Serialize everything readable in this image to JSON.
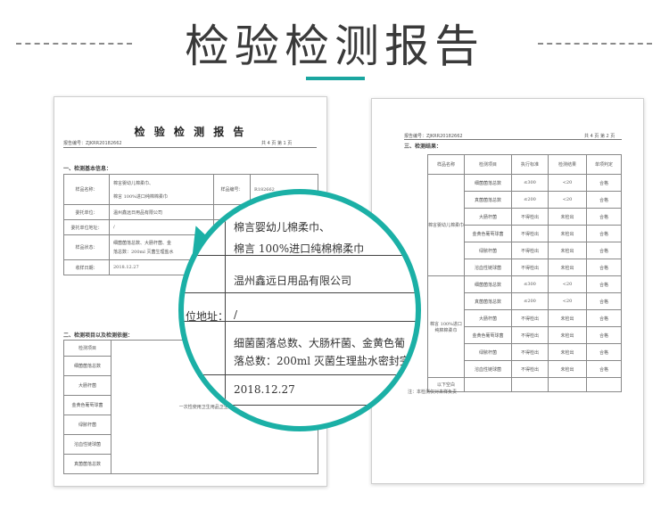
{
  "header": {
    "title": "检验检测报告"
  },
  "left_doc": {
    "title": "检 验 检 测 报 告",
    "report_no": "报告编号：ZJKRR20182662",
    "page": "共 4 页    第 1 页",
    "section1": "一、检测基本信息：",
    "sample_name_label": "样品名称：",
    "sample_name_line1": "棉言婴幼儿棉柔巾、",
    "sample_name_line2": "棉言 100%进口纯棉棉柔巾",
    "sample_no_label": "样品编号：",
    "sample_no_value": "R182662",
    "client_label": "委托单位：",
    "client_value": "温州鑫远日用品有限公司",
    "address_label": "委托单位地址：",
    "address_value": "/",
    "sample_state_label": "样品状态：",
    "sample_state_value": "细菌菌落总数、大肠杆菌、金",
    "sample_state_value2": "落总数：200ml 灭菌生理盐水",
    "receive_date_label": "收样日期：",
    "receive_date_value": "2018.12.27",
    "section2": "二、检测项目以及检测依据：",
    "items": [
      "检测项目",
      "细菌菌落总数",
      "大肠杆菌",
      "金黄色葡萄球菌",
      "绿脓杆菌",
      "溶血性链球菌",
      "真菌菌落总数"
    ],
    "basis_text": "一次性使用卫生用品卫生标准(GB 1"
  },
  "right_doc": {
    "report_no": "报告编号：ZJKRR20182662",
    "page": "共 4 页    第 2 页",
    "section": "三、检测结果：",
    "headers": [
      "样品名称",
      "检测项目",
      "执行标准",
      "检测结果",
      "单项判定"
    ],
    "group1_name": "棉言婴幼儿棉柔巾",
    "group2_name": "棉言 100%进口纯棉棉柔巾",
    "rows": [
      [
        "细菌菌落总数",
        "≤300",
        "<20",
        "合格"
      ],
      [
        "真菌菌落总数",
        "≤200",
        "<20",
        "合格"
      ],
      [
        "大肠杆菌",
        "不得检出",
        "未检出",
        "合格"
      ],
      [
        "金黄色葡萄球菌",
        "不得检出",
        "未检出",
        "合格"
      ],
      [
        "绿脓杆菌",
        "不得检出",
        "未检出",
        "合格"
      ],
      [
        "溶血性链球菌",
        "不得检出",
        "未检出",
        "合格"
      ],
      [
        "细菌菌落总数",
        "≤300",
        "<20",
        "合格"
      ],
      [
        "真菌菌落总数",
        "≤200",
        "<20",
        "合格"
      ],
      [
        "大肠杆菌",
        "不得检出",
        "未检出",
        "合格"
      ],
      [
        "金黄色葡萄球菌",
        "不得检出",
        "未检出",
        "合格"
      ],
      [
        "绿脓杆菌",
        "不得检出",
        "未检出",
        "合格"
      ],
      [
        "溶血性链球菌",
        "不得检出",
        "未检出",
        "合格"
      ]
    ],
    "blank_row": "以下空白",
    "note": "注：本检测仅对来样负责"
  },
  "magnifier": {
    "line1": "棉言婴幼儿棉柔巾、",
    "line2": "棉言 100%进口纯棉棉柔巾",
    "line3": "温州鑫远日用品有限公司",
    "label_address": "位地址：",
    "slash": "/",
    "line4": "细菌菌落总数、大肠杆菌、金黄色葡",
    "line5": "落总数：200ml 灭菌生理盐水密封完",
    "date": "2018.12.27"
  },
  "colors": {
    "accent": "#1bb0a6"
  }
}
